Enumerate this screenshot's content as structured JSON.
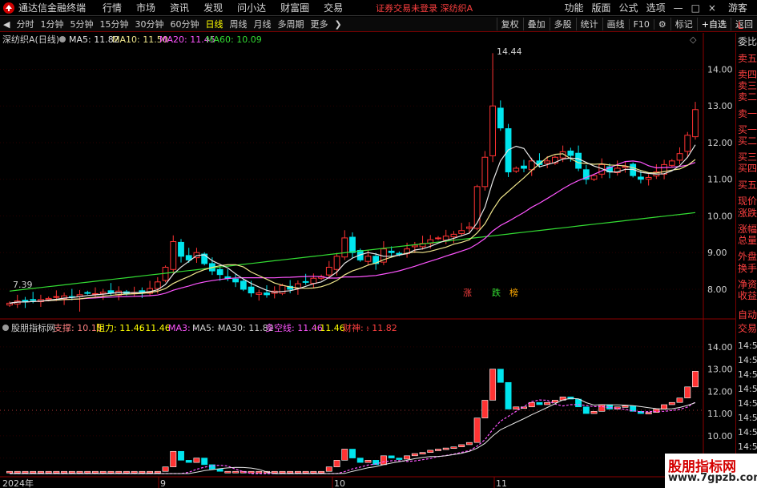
{
  "app": {
    "name": "通达信金融终端"
  },
  "menu": [
    "行情",
    "市场",
    "资讯",
    "发现",
    "问小达",
    "财富圈",
    "交易"
  ],
  "notice": "证券交易未登录  深纺织A",
  "right_menu": [
    "功能",
    "版面",
    "公式",
    "选项"
  ],
  "window_controls": [
    "—",
    "□",
    "×"
  ],
  "guest": "游客",
  "periods": [
    "分时",
    "1分钟",
    "5分钟",
    "15分钟",
    "30分钟",
    "60分钟",
    "日线",
    "周线",
    "月线",
    "多周期",
    "更多"
  ],
  "active_period": "日线",
  "right_tools": [
    "复权",
    "叠加",
    "多股",
    "统计",
    "画线",
    "F10",
    "标记",
    "+自选",
    "返回"
  ],
  "right_letter": "L",
  "main": {
    "title": "深纺织A(日线)",
    "ma": [
      {
        "label": "MA5: 11.82",
        "color": "#e6e6e6"
      },
      {
        "label": "MA10: 11.50",
        "color": "#f0e68c"
      },
      {
        "label": "MA20: 11.45",
        "color": "#ff55ff"
      },
      {
        "label": "MA60: 10.09",
        "color": "#33dd33"
      }
    ],
    "high_label": "14.44",
    "low_label": "7.39",
    "markers": [
      {
        "text": "涨",
        "color": "#ff4040"
      },
      {
        "text": "跌",
        "color": "#33dd33"
      },
      {
        "text": "榜",
        "color": "#ffaa00"
      }
    ]
  },
  "sub": {
    "title": "股朋指标网",
    "values": [
      {
        "label": "支撑: 10.15",
        "color": "#ff8080"
      },
      {
        "label": "阻力: 11.46",
        "color": "#ffff00"
      },
      {
        "label": ": 11.46",
        "color": "#ffff00"
      },
      {
        "label": "MA3: -",
        "color": "#ff55ff"
      },
      {
        "label": "MA5: -",
        "color": "#d0d0d0"
      },
      {
        "label": "MA30: 11.82",
        "color": "#d0d0d0"
      },
      {
        "label": "多空线: 11.46",
        "color": "#ff55ff"
      },
      {
        "label": ": 11.46",
        "color": "#ffff00"
      },
      {
        "label": "财神: -",
        "color": "#ff4040"
      },
      {
        "label": ": 11.82",
        "color": "#ff4040"
      }
    ]
  },
  "time_axis": [
    "2024年",
    "9",
    "10",
    "11"
  ],
  "side_panel": {
    "top": [
      "委比",
      "卖五",
      "卖四",
      "卖三",
      "卖二",
      "卖一",
      "买一",
      "买二",
      "买三",
      "买四",
      "买五",
      "现价",
      "涨跌",
      "涨幅",
      "总量",
      "外盘",
      "换手",
      "净资",
      "收益"
    ],
    "bottom": [
      "自动",
      "交易"
    ],
    "times": [
      "14:56",
      "14:56",
      "14:56",
      "14:56",
      "14:56",
      "14:56",
      "14:56",
      "14:56"
    ]
  },
  "colors": {
    "up": "#ff3333",
    "down": "#00e5ee",
    "ma5": "#e6e6e6",
    "ma10": "#f0e68c",
    "ma20": "#ff55ff",
    "ma60": "#33dd33"
  },
  "chart_data": [
    {
      "type": "candlestick",
      "title": "深纺织A(日线)",
      "y_ticks": [
        8.0,
        9.0,
        10.0,
        11.0,
        12.0,
        13.0,
        14.0
      ],
      "ylim": [
        7.3,
        14.6
      ],
      "x_labels": [
        "2024年",
        "9",
        "10",
        "11"
      ],
      "close": [
        7.62,
        7.68,
        7.66,
        7.7,
        7.72,
        7.75,
        7.8,
        7.82,
        7.78,
        7.85,
        7.9,
        7.88,
        7.92,
        7.9,
        7.95,
        7.88,
        7.9,
        7.93,
        8.02,
        8.2,
        8.6,
        9.3,
        8.9,
        8.8,
        9.0,
        8.7,
        8.5,
        8.4,
        8.3,
        8.2,
        8.0,
        7.9,
        7.9,
        7.85,
        7.95,
        8.1,
        8.0,
        8.15,
        8.2,
        8.3,
        8.35,
        8.6,
        8.9,
        9.4,
        9.0,
        8.8,
        8.9,
        8.7,
        9.1,
        9.0,
        8.95,
        9.1,
        9.2,
        9.25,
        9.35,
        9.4,
        9.45,
        9.5,
        9.6,
        9.7,
        10.8,
        11.6,
        13.0,
        12.4,
        11.2,
        11.3,
        11.3,
        11.5,
        11.4,
        11.5,
        11.6,
        11.75,
        11.65,
        11.3,
        11.0,
        11.1,
        11.4,
        11.2,
        11.3,
        11.35,
        11.1,
        11.0,
        11.05,
        11.2,
        11.4,
        11.5,
        11.7,
        12.2,
        12.9
      ],
      "ma5_last": 11.82,
      "ma10_last": 11.5,
      "ma20_last": 11.45,
      "ma60_last": 10.09,
      "high": 14.44,
      "low": 7.39
    },
    {
      "type": "indicator",
      "title": "股朋指标网",
      "y_ticks": [
        9.0,
        10.0,
        11.0,
        12.0,
        13.0,
        14.0
      ],
      "ylim": [
        8.3,
        14.5
      ],
      "support": 10.15,
      "resistance": 11.46
    }
  ]
}
